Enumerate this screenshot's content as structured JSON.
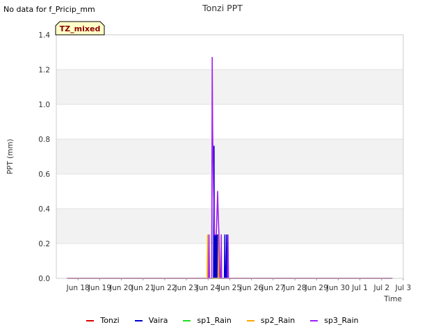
{
  "header": {
    "no_data_note": "No data for f_Pricip_mm"
  },
  "chart_data": {
    "type": "line",
    "title": "Tonzi PPT",
    "xlabel": "Time",
    "ylabel": "PPT (mm)",
    "ylim": [
      0,
      1.4
    ],
    "yticks": [
      "0.0",
      "0.2",
      "0.4",
      "0.6",
      "0.8",
      "1.0",
      "1.2",
      "1.4"
    ],
    "xlim": [
      "2024-06-17",
      "2024-07-03"
    ],
    "xtick_labels": [
      "Jun 18",
      "Jun 19",
      "Jun 20",
      "Jun 21",
      "Jun 22",
      "Jun 23",
      "Jun 24",
      "Jun 25",
      "Jun 26",
      "Jun 27",
      "Jun 28",
      "Jun 29",
      "Jun 30",
      "Jul 1",
      "Jul 2",
      "Jul 3"
    ],
    "xtick_dates": [
      "2024-06-18",
      "2024-06-19",
      "2024-06-20",
      "2024-06-21",
      "2024-06-22",
      "2024-06-23",
      "2024-06-24",
      "2024-06-25",
      "2024-06-26",
      "2024-06-27",
      "2024-06-28",
      "2024-06-29",
      "2024-06-30",
      "2024-07-01",
      "2024-07-02",
      "2024-07-03"
    ],
    "grid": true,
    "legend_position": "bottom",
    "annotation": {
      "text": "TZ_mixed",
      "color": "#8b0000",
      "background": "#ffffc8"
    },
    "series": [
      {
        "name": "Tonzi",
        "color": "#dd0000",
        "x": [
          "2024-06-17 12:00",
          "2024-06-24 08:00",
          "2024-06-24 08:30",
          "2024-06-24 09:00",
          "2024-06-24 09:30",
          "2024-06-24 10:00",
          "2024-06-24 10:30",
          "2024-06-24 11:00",
          "2024-07-02 12:00"
        ],
        "y": [
          0,
          0,
          0.25,
          0,
          0,
          0.25,
          0,
          0,
          0
        ]
      },
      {
        "name": "Vaira",
        "color": "#0000cc",
        "x": [
          "2024-06-17 12:00",
          "2024-06-24 06:00",
          "2024-06-24 06:30",
          "2024-06-24 07:00",
          "2024-06-24 07:30",
          "2024-06-24 08:00",
          "2024-06-24 08:30",
          "2024-06-24 09:00",
          "2024-06-24 09:30",
          "2024-06-24 10:00",
          "2024-06-24 10:30",
          "2024-06-24 11:00",
          "2024-06-24 18:00",
          "2024-06-24 18:30",
          "2024-06-24 19:00",
          "2024-06-24 20:00",
          "2024-06-24 20:30",
          "2024-06-24 21:00",
          "2024-07-02 12:00"
        ],
        "y": [
          0,
          0,
          0.76,
          0,
          0.25,
          0,
          0.25,
          0,
          0.25,
          0,
          0.25,
          0,
          0,
          0.25,
          0,
          0,
          0.25,
          0,
          0
        ]
      },
      {
        "name": "sp1_Rain",
        "color": "#22dd22",
        "x": [
          "2024-06-17 12:00",
          "2024-07-02 12:00"
        ],
        "y": [
          0,
          0
        ]
      },
      {
        "name": "sp2_Rain",
        "color": "#ffa500",
        "x": [
          "2024-06-17 12:00",
          "2024-06-23 23:00",
          "2024-06-23 23:30",
          "2024-06-24 00:00",
          "2024-06-24 11:00",
          "2024-06-24 11:30",
          "2024-06-24 12:00",
          "2024-07-02 12:00"
        ],
        "y": [
          0,
          0,
          0.25,
          0,
          0,
          0.25,
          0,
          0
        ]
      },
      {
        "name": "sp3_Rain",
        "color": "#a020f0",
        "x": [
          "2024-06-17 12:00",
          "2024-06-24 00:30",
          "2024-06-24 01:00",
          "2024-06-24 01:30",
          "2024-06-24 04:00",
          "2024-06-24 04:30",
          "2024-06-24 05:00",
          "2024-06-24 06:00",
          "2024-06-24 07:00",
          "2024-06-24 08:00",
          "2024-06-24 09:00",
          "2024-06-24 10:00",
          "2024-06-24 10:30",
          "2024-06-24 11:00",
          "2024-06-24 12:00",
          "2024-06-24 13:00",
          "2024-06-24 14:00",
          "2024-06-24 14:30",
          "2024-06-24 15:00",
          "2024-06-24 21:30",
          "2024-06-24 22:00",
          "2024-06-24 22:30",
          "2024-07-02 12:00"
        ],
        "y": [
          0,
          0,
          0.25,
          0,
          0,
          1.27,
          0.85,
          0.5,
          0.25,
          0.25,
          0.25,
          0.4,
          0.5,
          0.4,
          0.25,
          0,
          0,
          0.25,
          0,
          0,
          0.25,
          0,
          0
        ]
      }
    ]
  }
}
